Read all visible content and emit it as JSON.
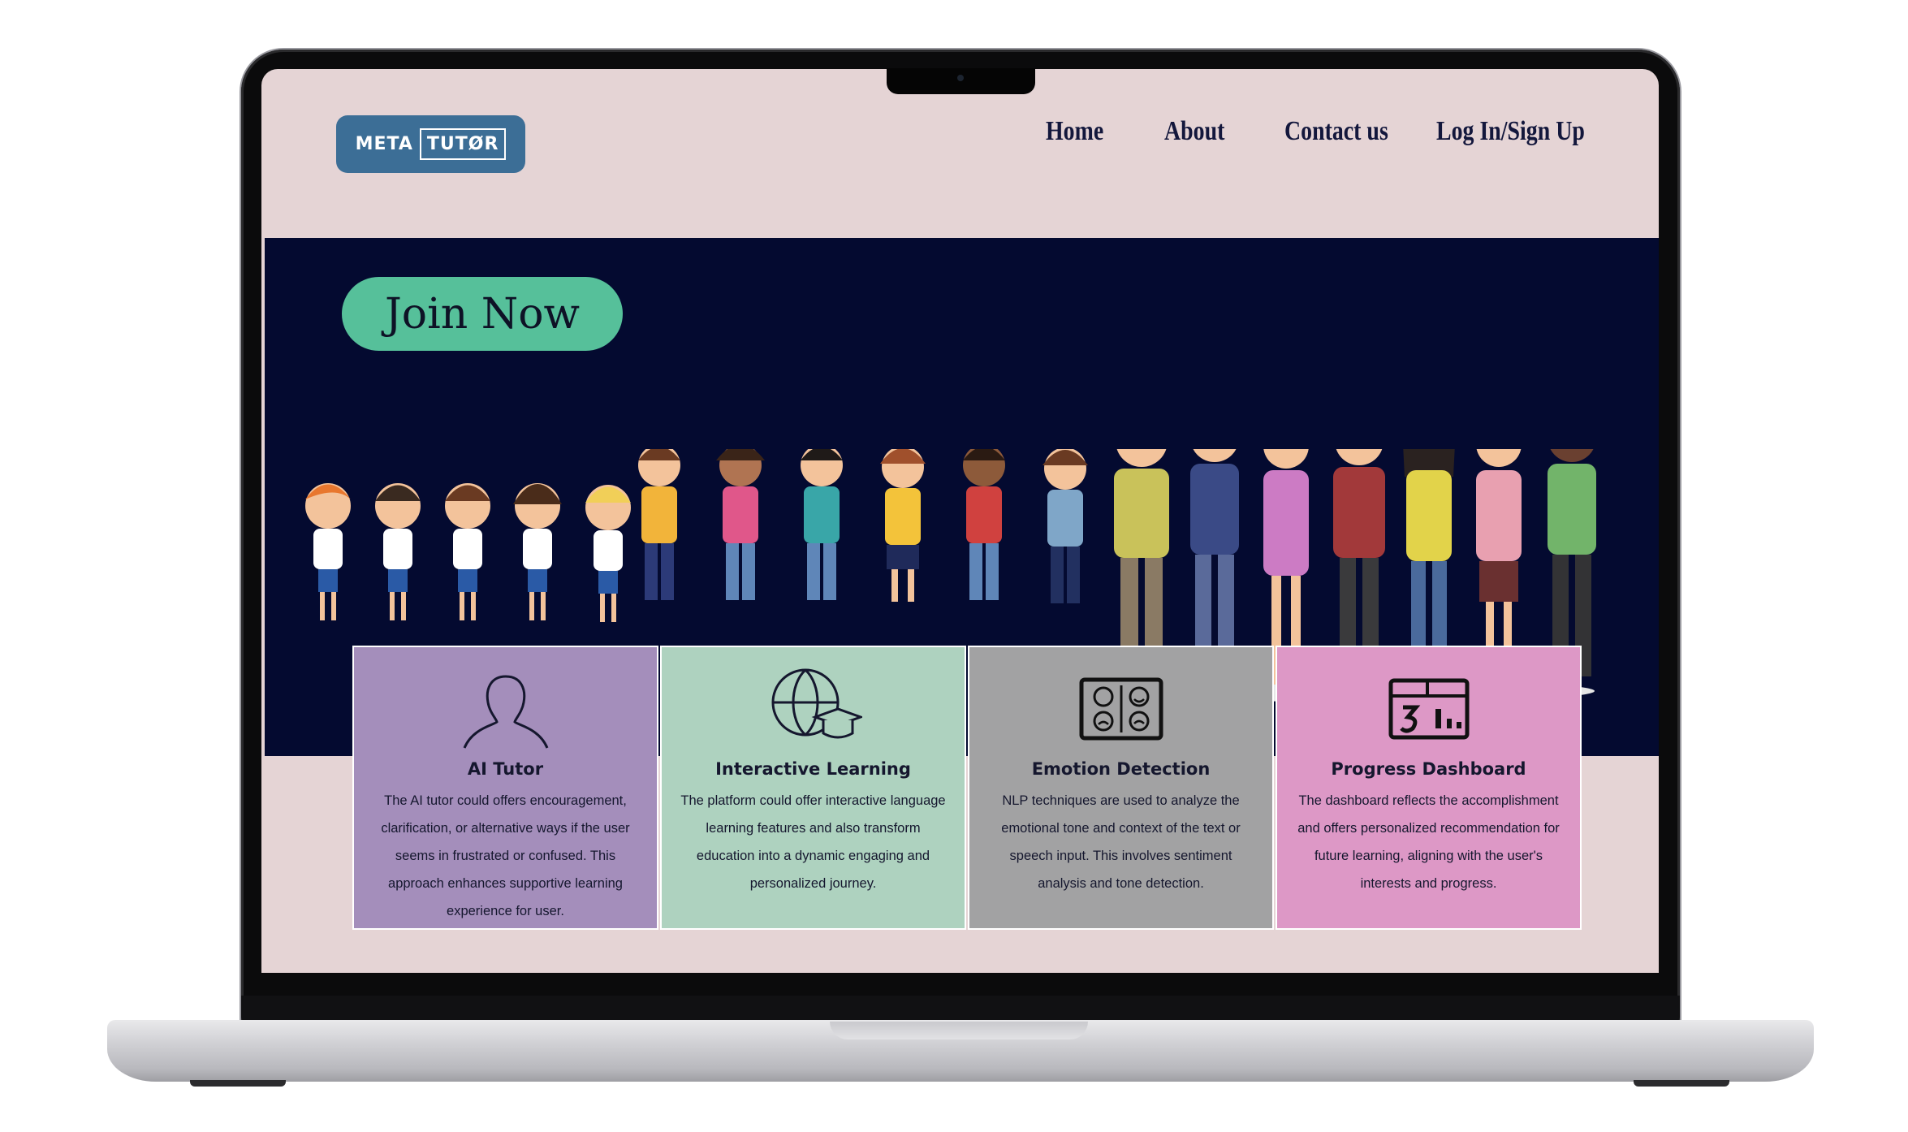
{
  "logo": {
    "part1": "META",
    "part2": "TUTØR"
  },
  "nav": {
    "home": "Home",
    "about": "About",
    "contact": "Contact us",
    "login": "Log In/Sign Up"
  },
  "hero": {
    "join_label": "Join Now"
  },
  "cards": [
    {
      "title": "AI Tutor",
      "text": "The AI tutor could offers encouragement, clarification, or alternative ways if the user seems in frustrated or confused. This approach enhances supportive learning experience for user.",
      "icon": "user-icon",
      "color": "#a48ebb"
    },
    {
      "title": "Interactive Learning",
      "text": "The platform could offer interactive language learning features and also transform education into a dynamic engaging and personalized journey.",
      "icon": "globe-graduation-icon",
      "color": "#aed2bf"
    },
    {
      "title": "Emotion Detection",
      "text": "NLP techniques are used to analyze the emotional tone and context of the text or speech input. This involves sentiment analysis and tone detection.",
      "icon": "emotion-faces-icon",
      "color": "#a2a2a3"
    },
    {
      "title": "Progress Dashboard",
      "text": "The dashboard reflects the accomplishment and offers personalized recommendation for future learning, aligning with the user's interests and progress.",
      "icon": "dashboard-icon",
      "color": "#dd98c6"
    }
  ]
}
